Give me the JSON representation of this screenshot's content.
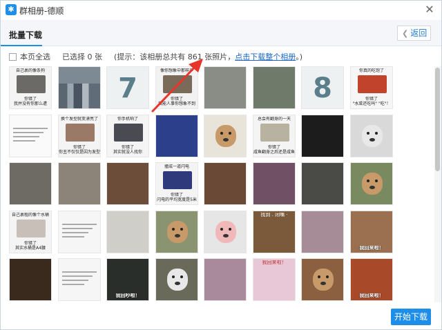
{
  "window": {
    "title": "群相册-德顺",
    "close_glyph": "✕",
    "app_icon_glyph": "✱"
  },
  "header": {
    "page_title": "批量下载",
    "back_label": "返回",
    "back_glyph": "❮"
  },
  "info": {
    "select_all_label": "本页全选",
    "selected_text": "已选择 0 张",
    "hint_prefix": "(提示：该相册总共有 861 张照片，",
    "hint_link": "点击下载整个相册",
    "hint_suffix": "。)"
  },
  "footer": {
    "start_label": "开始下载"
  },
  "colors": {
    "accent": "#1e8ee8",
    "link": "#1a66c9",
    "arrow": "#e8352b"
  },
  "photos": [
    {
      "r": 0,
      "c": 0,
      "bg": "#f4f4f4",
      "top": "自己裹的像条狗",
      "bot": "你错了\n我并没有你那么遭",
      "img": "#6b6a66",
      "icon": ""
    },
    {
      "r": 0,
      "c": 1,
      "bg": "#7d8a94",
      "top": "",
      "bot": "",
      "img": "",
      "icon": "city"
    },
    {
      "r": 0,
      "c": 2,
      "bg": "#eef1f1",
      "top": "",
      "bot": "",
      "img": "",
      "icon": "7"
    },
    {
      "r": 0,
      "c": 3,
      "bg": "#f2f2f2",
      "top": "像你想象中那样辛",
      "bot": "你错了\n我能人事你想象不到",
      "img": "#7a6a5a",
      "icon": ""
    },
    {
      "r": 0,
      "c": 4,
      "bg": "#8a8c86",
      "top": "",
      "bot": "",
      "img": "",
      "icon": ""
    },
    {
      "r": 0,
      "c": 5,
      "bg": "#6f7a6a",
      "top": "",
      "bot": "",
      "img": "",
      "icon": ""
    },
    {
      "r": 0,
      "c": 6,
      "bg": "#eef1f2",
      "top": "",
      "bot": "",
      "img": "",
      "icon": "8"
    },
    {
      "r": 0,
      "c": 7,
      "bg": "#f6f6f6",
      "top": "你真的吃饱了",
      "bot": "你错了\n\"水菜还吃吗\" \"吃\"！",
      "img": "#c2432b",
      "icon": ""
    },
    {
      "r": 1,
      "c": 0,
      "bg": "#fafafa",
      "top": "",
      "bot": "",
      "img": "",
      "icon": "text"
    },
    {
      "r": 1,
      "c": 1,
      "bg": "#f4f4f4",
      "top": "换个发型就变漂亮了",
      "bot": "你错了\n你丑不仅仅是因为发型",
      "img": "#9a7a66",
      "icon": ""
    },
    {
      "r": 1,
      "c": 2,
      "bg": "#f4f4f4",
      "top": "你手机响了",
      "bot": "你错了\n其实就没人找你",
      "img": "#4a4a52",
      "icon": ""
    },
    {
      "r": 1,
      "c": 3,
      "bg": "#2c3f8a",
      "top": "",
      "bot": "",
      "img": "",
      "icon": ""
    },
    {
      "r": 1,
      "c": 4,
      "bg": "#e9e4da",
      "top": "",
      "bot": "",
      "img": "",
      "icon": "dog"
    },
    {
      "r": 1,
      "c": 5,
      "bg": "#f4f4f4",
      "top": "总会有翻身的一天",
      "bot": "你错了\n咸鱼翻身之后还是咸鱼",
      "img": "#b8b2a0",
      "icon": ""
    },
    {
      "r": 1,
      "c": 6,
      "bg": "#1c1c1c",
      "top": "",
      "bot": "",
      "img": "",
      "icon": ""
    },
    {
      "r": 1,
      "c": 7,
      "bg": "#d9d9d9",
      "top": "",
      "bot": "",
      "img": "",
      "icon": "husky"
    },
    {
      "r": 2,
      "c": 0,
      "bg": "#6e6a64",
      "top": "",
      "bot": "",
      "img": "",
      "icon": ""
    },
    {
      "r": 2,
      "c": 1,
      "bg": "#8c8478",
      "top": "",
      "bot": "",
      "img": "",
      "icon": ""
    },
    {
      "r": 2,
      "c": 2,
      "bg": "#6b4d3a",
      "top": "",
      "bot": "",
      "img": "",
      "icon": ""
    },
    {
      "r": 2,
      "c": 3,
      "bg": "#f4f4f4",
      "top": "撞成一道闪电",
      "bot": "你错了\n闪电的平均宽度是5米",
      "img": "#2e3a7c",
      "icon": ""
    },
    {
      "r": 2,
      "c": 4,
      "bg": "#6a4a36",
      "top": "",
      "bot": "",
      "img": "",
      "icon": ""
    },
    {
      "r": 2,
      "c": 5,
      "bg": "#6f5064",
      "top": "",
      "bot": "",
      "img": "",
      "icon": ""
    },
    {
      "r": 2,
      "c": 6,
      "bg": "#4a4a46",
      "top": "",
      "bot": "",
      "img": "",
      "icon": ""
    },
    {
      "r": 2,
      "c": 7,
      "bg": "#7a8a60",
      "top": "",
      "bot": "",
      "img": "",
      "icon": "dog"
    },
    {
      "r": 3,
      "c": 0,
      "bg": "#f4f4f4",
      "top": "自己裹粗的像个水桶",
      "bot": "你错了\n其实水桶是A4腰",
      "img": "#c8c0b8",
      "icon": ""
    },
    {
      "r": 3,
      "c": 1,
      "bg": "#f6f6f6",
      "top": "",
      "bot": "",
      "img": "",
      "icon": "text"
    },
    {
      "r": 3,
      "c": 2,
      "bg": "#d0cec8",
      "top": "",
      "bot": "",
      "img": "",
      "icon": ""
    },
    {
      "r": 3,
      "c": 3,
      "bg": "#8a9470",
      "top": "",
      "bot": "",
      "img": "",
      "icon": "dog"
    },
    {
      "r": 3,
      "c": 4,
      "bg": "#e6e6e6",
      "top": "",
      "bot": "",
      "img": "",
      "icon": "pig"
    },
    {
      "r": 3,
      "c": 5,
      "bg": "#7a5a3a",
      "top": "找到 . 闭嘴 ·",
      "bot": "",
      "img": "",
      "icon": ""
    },
    {
      "r": 3,
      "c": 6,
      "bg": "#a68c96",
      "top": "",
      "bot": "",
      "img": "",
      "icon": ""
    },
    {
      "r": 3,
      "c": 7,
      "bg": "#9a7050",
      "top": "",
      "bot": "我回来啦！",
      "img": "",
      "icon": ""
    },
    {
      "r": 4,
      "c": 0,
      "bg": "#3a2a1e",
      "top": "",
      "bot": "",
      "img": "",
      "icon": ""
    },
    {
      "r": 4,
      "c": 1,
      "bg": "#f6f6f6",
      "top": "",
      "bot": "",
      "img": "",
      "icon": "text"
    },
    {
      "r": 4,
      "c": 2,
      "bg": "#2a2e2a",
      "top": "",
      "bot": "我回吵啦！",
      "img": "",
      "icon": ""
    },
    {
      "r": 4,
      "c": 3,
      "bg": "#6a6a5a",
      "top": "",
      "bot": "",
      "img": "",
      "icon": "husky"
    },
    {
      "r": 4,
      "c": 4,
      "bg": "#a88a9c",
      "top": "",
      "bot": "",
      "img": "",
      "icon": ""
    },
    {
      "r": 4,
      "c": 5,
      "bg": "#e8c8d6",
      "top": "我回来啦！",
      "bot": "",
      "img": "",
      "icon": ""
    },
    {
      "r": 4,
      "c": 6,
      "bg": "#8a6040",
      "top": "",
      "bot": "",
      "img": "",
      "icon": "dog"
    },
    {
      "r": 4,
      "c": 7,
      "bg": "#a84a2a",
      "top": "",
      "bot": "我回来啦！",
      "img": "",
      "icon": ""
    }
  ]
}
